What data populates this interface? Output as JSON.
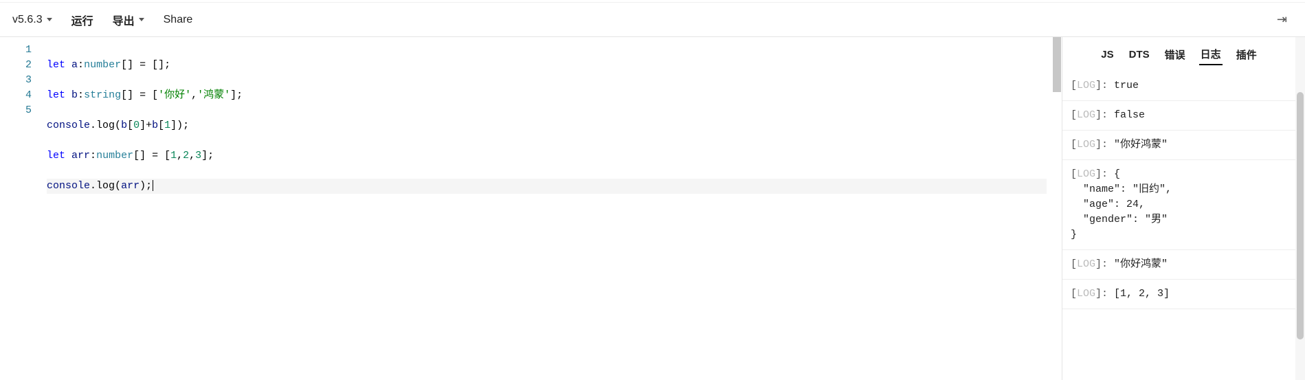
{
  "toolbar": {
    "version": "v5.6.3",
    "run": "运行",
    "export": "导出",
    "share": "Share"
  },
  "tok": {
    "let": "let",
    "number": "number",
    "string": "string",
    "console": "console",
    "log": "log"
  },
  "editor": {
    "lines": [
      {
        "n": "1",
        "v0": "a"
      },
      {
        "n": "2",
        "v0": "b",
        "s0": "'你好'",
        "s1": "'鸿蒙'"
      },
      {
        "n": "3",
        "v0": "b",
        "i0": "0",
        "i1": "1"
      },
      {
        "n": "4",
        "v0": "arr",
        "a0": "1",
        "a1": "2",
        "a2": "3"
      },
      {
        "n": "5",
        "v0": "arr"
      }
    ]
  },
  "tabs": [
    "JS",
    "DTS",
    "错误",
    "日志",
    "插件"
  ],
  "logTag": "LOG",
  "logs": [
    "true",
    "false",
    "\"你好鸿蒙\"",
    "{\n  \"name\": \"旧约\",\n  \"age\": 24,\n  \"gender\": \"男\"\n}",
    "\"你好鸿蒙\"",
    "[1, 2, 3]"
  ]
}
